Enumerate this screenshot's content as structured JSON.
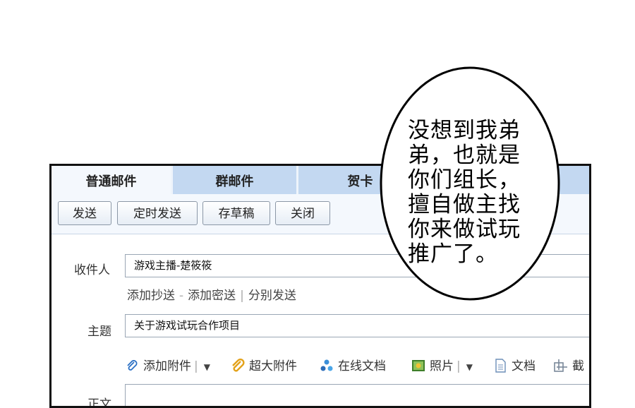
{
  "tabs": [
    {
      "label": "普通邮件"
    },
    {
      "label": "群邮件"
    },
    {
      "label": "贺卡"
    }
  ],
  "toolbar": {
    "send": "发送",
    "scheduled_send": "定时发送",
    "save_draft": "存草稿",
    "close": "关闭"
  },
  "form": {
    "recipient_label": "收件人",
    "recipient_value": "游戏主播-楚筱筱",
    "add_cc": "添加抄送",
    "add_bcc": "添加密送",
    "separate_send": "分别发送",
    "subject_label": "主题",
    "subject_value": "关于游戏试玩合作项目",
    "body_label": "正文"
  },
  "attachments": [
    {
      "label": "添加附件",
      "icon": "paperclip-icon"
    },
    {
      "label": "超大附件",
      "icon": "large-attachment-icon"
    },
    {
      "label": "在线文档",
      "icon": "online-doc-icon"
    },
    {
      "label": "照片",
      "icon": "photo-icon"
    },
    {
      "label": "文档",
      "icon": "document-icon"
    },
    {
      "label": "截",
      "icon": "screenshot-icon"
    }
  ],
  "speech_bubble": {
    "lines": [
      "没想到我弟",
      "弟，也就是",
      "你们组长，",
      "擅自做主找",
      "你来做试玩",
      "推广了。"
    ]
  }
}
